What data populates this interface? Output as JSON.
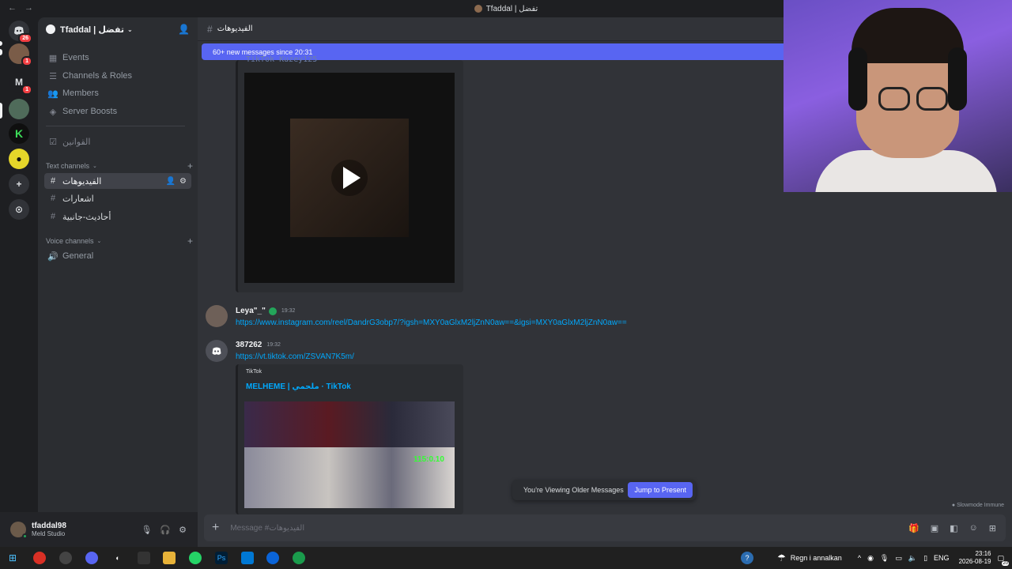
{
  "window": {
    "title": "Tfaddal | تفضل",
    "back": "←",
    "forward": "→"
  },
  "rail": {
    "dm_badge": "26",
    "server_badge_1": "1",
    "server_m_label": "M",
    "server_m_badge": "1",
    "add_server": "+",
    "discover": "⊙"
  },
  "server": {
    "name": "Tfaddal | تفضل",
    "chevron": "⌄"
  },
  "sidebar": {
    "events": "Events",
    "channels_roles": "Channels & Roles",
    "members": "Members",
    "server_boosts": "Server Boosts",
    "rules_channel": "القوانين",
    "text_category": "Text channels",
    "voice_category": "Voice channels",
    "text_channels": [
      "الفيديوهات",
      "اشعارات",
      "أحاديث-جانبية"
    ],
    "voice_channels": [
      "General"
    ]
  },
  "user": {
    "name": "tfaddal98",
    "status": "Meld Studio"
  },
  "chat": {
    "channel_name": "الفيديوهات",
    "new_messages_bar": "60+ new messages since 20:31",
    "cut_off_title": "TikTok Kuzey125",
    "messages": [
      {
        "author": "Leya\"_\"",
        "time": "19:32",
        "link": "https://www.instagram.com/reel/DandrG3obp7/?igsh=MXY0aGlxM2ljZnN0aw==&igsi=MXY0aGlxM2ljZnN0aw=="
      },
      {
        "author": "387262",
        "time": "19:32",
        "link": "https://vt.tiktok.com/ZSVAN7K5m/",
        "embed_provider": "TikTok",
        "embed_title": "MELHEME | ملحمي · TikTok",
        "overlay_text": "115:0.10"
      }
    ],
    "older_notice": "You're Viewing Older Messages",
    "jump_button": "Jump to Present",
    "slowmode": "Slowmode Immune",
    "composer_placeholder": "Message #الفيديوهات"
  },
  "taskbar": {
    "weather": "Regn i annalkan",
    "language": "ENG",
    "time": "23:16",
    "date": "2026-08-19",
    "notifications": "20"
  },
  "colors": {
    "accent": "#5865f2",
    "link": "#00a8fc",
    "online": "#23a55a",
    "danger": "#f23f43"
  }
}
